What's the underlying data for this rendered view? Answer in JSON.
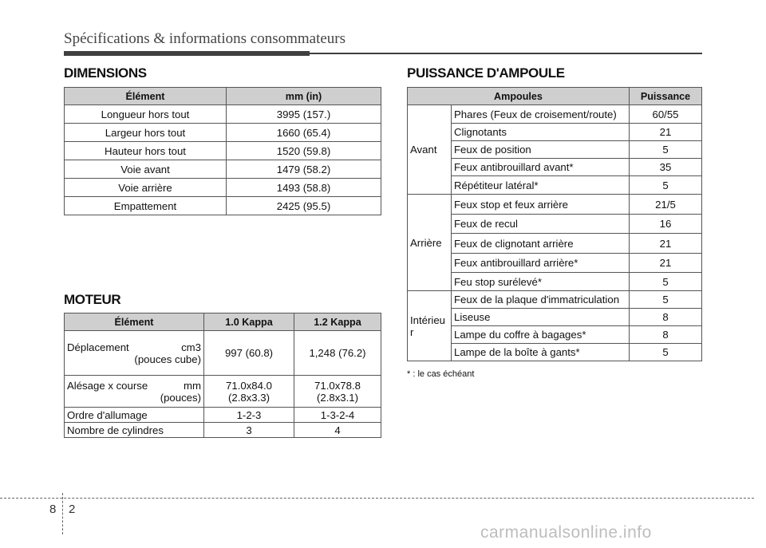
{
  "header": {
    "title": "Spécifications & informations consommateurs"
  },
  "dimensions": {
    "title": "DIMENSIONS",
    "headers": [
      "Élément",
      "mm (in)"
    ],
    "rows": [
      {
        "item": "Longueur hors tout",
        "value": "3995 (157.)"
      },
      {
        "item": "Largeur hors tout",
        "value": "1660 (65.4)"
      },
      {
        "item": "Hauteur hors tout",
        "value": "1520 (59.8)"
      },
      {
        "item": "Voie avant",
        "value": "1479 (58.2)"
      },
      {
        "item": "Voie arrière",
        "value": "1493 (58.8)"
      },
      {
        "item": "Empattement",
        "value": "2425 (95.5)"
      }
    ]
  },
  "moteur": {
    "title": "MOTEUR",
    "headers": [
      "Élément",
      "1.0 Kappa",
      "1.2 Kappa"
    ],
    "rows": [
      {
        "item_a": "Déplacement",
        "item_a_unit": "cm3",
        "item_b": "(pouces cube)",
        "v1": "997 (60.8)",
        "v2": "1,248 (76.2)"
      },
      {
        "item_a": "Alésage x course",
        "item_a_unit": "mm",
        "item_b": "(pouces)",
        "v1a": "71.0x84.0",
        "v1b": "(2.8x3.3)",
        "v2a": "71.0x78.8",
        "v2b": "(2.8x3.1)"
      },
      {
        "item": "Ordre d'allumage",
        "v1": "1-2-3",
        "v2": "1-3-2-4"
      },
      {
        "item": "Nombre de cylindres",
        "v1": "3",
        "v2": "4"
      }
    ]
  },
  "ampoule": {
    "title": "PUISSANCE D'AMPOULE",
    "headers": [
      "Ampoules",
      "Puissance"
    ],
    "groups": [
      {
        "label": "Avant",
        "rows": [
          {
            "name": "Phares (Feux de croisement/route)",
            "power": "60/55"
          },
          {
            "name": "Clignotants",
            "power": "21"
          },
          {
            "name": "Feux de position",
            "power": "5"
          },
          {
            "name": "Feux antibrouillard avant*",
            "power": "35"
          },
          {
            "name": "Répétiteur latéral*",
            "power": "5"
          }
        ]
      },
      {
        "label": "Arrière",
        "rows": [
          {
            "name": "Feux stop et feux arrière",
            "power": "21/5"
          },
          {
            "name": "Feux de recul",
            "power": "16"
          },
          {
            "name": "Feux de clignotant arrière",
            "power": "21"
          },
          {
            "name": "Feux antibrouillard arrière*",
            "power": "21"
          },
          {
            "name": "Feu stop surélevé*",
            "power": "5"
          }
        ]
      },
      {
        "label_a": "Intérieu",
        "label_b": "r",
        "rows": [
          {
            "name": "Feux de la plaque d'immatriculation",
            "power": "5"
          },
          {
            "name": "Liseuse",
            "power": "8"
          },
          {
            "name": "Lampe du coffre à bagages*",
            "power": "8"
          },
          {
            "name": "Lampe de la boîte à gants*",
            "power": "5"
          }
        ]
      }
    ],
    "footnote": "* : le cas échéant"
  },
  "footer": {
    "page_chapter": "8",
    "page_number": "2"
  },
  "watermark": "carmanualsonline.info"
}
